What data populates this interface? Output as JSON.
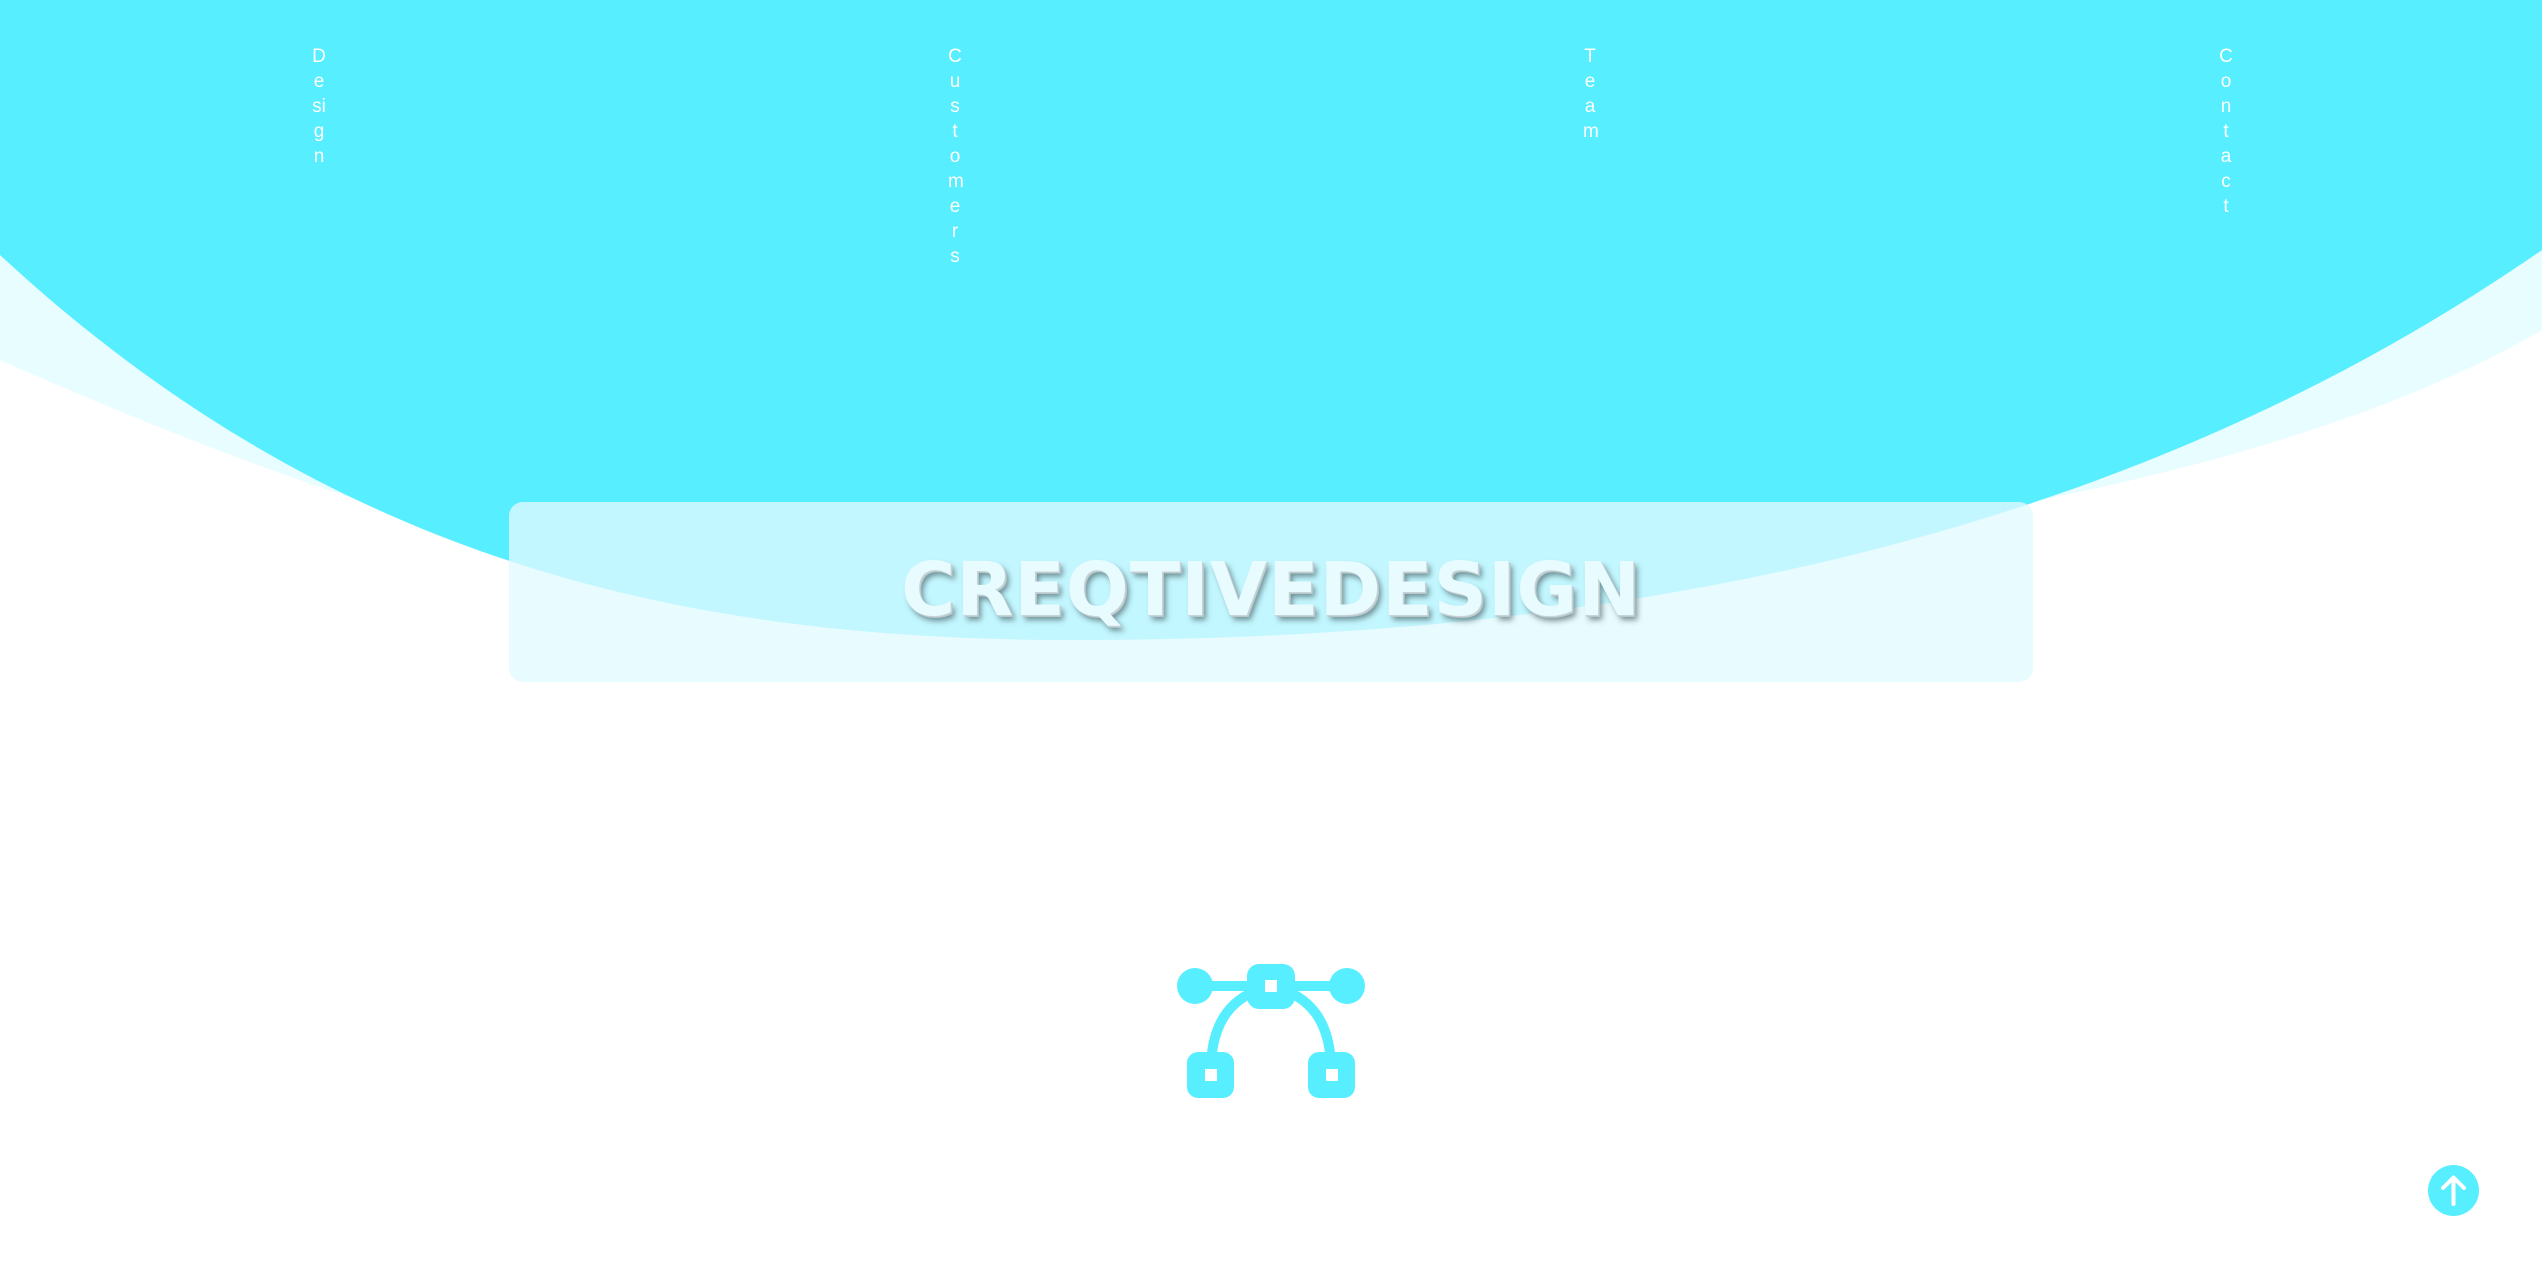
{
  "nav": {
    "items": [
      {
        "label": "Design"
      },
      {
        "label": "Customers"
      },
      {
        "label": "Team"
      },
      {
        "label": "Contact"
      }
    ]
  },
  "hero": {
    "title": "CREQTIVEDESIGN"
  },
  "icons": {
    "feature_icon": "bezier-curve-icon",
    "scroll_top_icon": "arrow-up-icon"
  },
  "colors": {
    "accent": "#57eeff",
    "pale_accent": "#e8fdff",
    "card": "#e2faff",
    "text_light": "#ffffff"
  }
}
